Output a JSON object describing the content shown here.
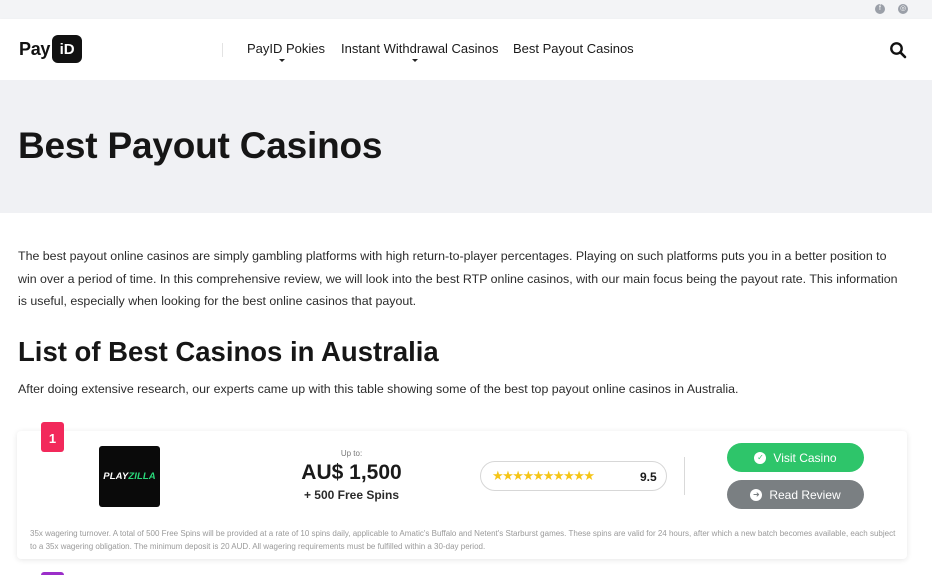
{
  "topbar": {
    "icons": [
      "facebook-icon",
      "globe-icon"
    ]
  },
  "header": {
    "logo_text": "Pay",
    "logo_badge": "iD",
    "nav": [
      {
        "label": "PayID Pokies",
        "has_dropdown": true
      },
      {
        "label": "Instant Withdrawal Casinos",
        "has_dropdown": true
      },
      {
        "label": "Best Payout Casinos",
        "has_dropdown": false
      }
    ],
    "search_icon": "search-icon"
  },
  "hero": {
    "title": "Best Payout Casinos"
  },
  "content": {
    "intro": "The best payout online casinos are simply gambling platforms with high return-to-player percentages. Playing on such platforms puts you in a better position to win over a period of time. In this comprehensive review, we will look into the best RTP online casinos, with our main focus being the payout rate. This information is useful, especially when looking for the best online casinos that payout.",
    "section_title": "List of Best Casinos in Australia",
    "section_sub": "After doing extensive research, our experts came up with this table showing some of the best top payout online casinos in Australia."
  },
  "casino_card": {
    "rank": "1",
    "logo_text_a": "PLAY",
    "logo_text_b": "ZILLA",
    "bonus_upto": "Up to:",
    "bonus_amount": "AU$ 1,500",
    "bonus_spins": "+ 500 Free Spins",
    "stars": "★★★★★★★★★★",
    "rating": "9.5",
    "visit_label": "Visit Casino",
    "review_label": "Read Review",
    "terms": "35x wagering turnover. A total of 500 Free Spins will be provided at a rate of 10 spins daily, applicable to Amatic's Buffalo and Netent's Starburst games. These spins are valid for 24 hours, after which a new batch becomes available, each subject to a 35x wagering obligation. The minimum deposit is 20 AUD. All wagering requirements must be fulfilled within a 30-day period."
  },
  "colors": {
    "rank_badge": "#f2295b",
    "visit_button": "#2ec56a",
    "review_button": "#7a7f82",
    "stars": "#f5c518",
    "hero_bg": "#f0f1f4"
  }
}
